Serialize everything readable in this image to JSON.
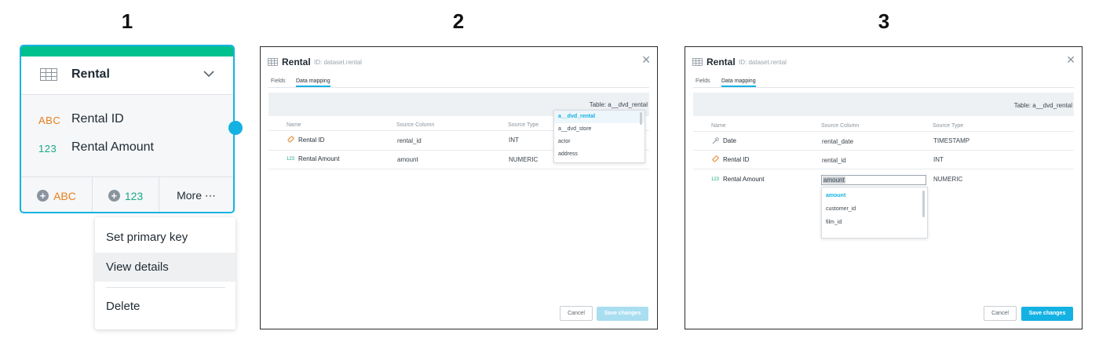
{
  "steps": [
    "1",
    "2",
    "3"
  ],
  "panel1": {
    "card": {
      "title": "Rental",
      "fields": [
        {
          "type": "ABC",
          "name": "Rental ID",
          "type_color": "#e87f1a"
        },
        {
          "type": "123",
          "name": "Rental Amount",
          "type_color": "#1aa882"
        }
      ],
      "footer": {
        "add_attribute_label": "ABC",
        "add_fact_label": "123",
        "more_label": "More ⋯"
      }
    },
    "menu": {
      "items": [
        "Set primary key",
        "View details",
        "Delete"
      ],
      "highlighted": "View details"
    }
  },
  "dialog2": {
    "title": "Rental",
    "id_text": "ID: dataset.rental",
    "tabs": [
      "Fields",
      "Data mapping"
    ],
    "active_tab": "Data mapping",
    "table_label": "Table: a__dvd_rental",
    "columns": [
      "Name",
      "Source Column",
      "Source Type"
    ],
    "rows": [
      {
        "icon": "key-icon",
        "name": "Rental ID",
        "source": "rental_id",
        "type": "INT"
      },
      {
        "icon": "123",
        "name": "Rental Amount",
        "source": "amount",
        "type": "NUMERIC"
      }
    ],
    "dropdown": [
      "a__dvd_rental",
      "a__dvd_store",
      "actor",
      "address"
    ],
    "dropdown_selected": "a__dvd_rental",
    "cancel_label": "Cancel",
    "save_label": "Save changes",
    "save_enabled": false
  },
  "dialog3": {
    "title": "Rental",
    "id_text": "ID: dataset.rental",
    "tabs": [
      "Fields",
      "Data mapping"
    ],
    "active_tab": "Data mapping",
    "table_label": "Table: a__dvd_rental",
    "columns": [
      "Name",
      "Source Column",
      "Source Type"
    ],
    "rows": [
      {
        "icon": "date-icon",
        "name": "Date",
        "source": "rental_date",
        "type": "TIMESTAMP"
      },
      {
        "icon": "key-icon",
        "name": "Rental ID",
        "source": "rental_id",
        "type": "INT"
      },
      {
        "icon": "123",
        "name": "Rental Amount",
        "source": "amount",
        "type": "NUMERIC"
      }
    ],
    "dropdown": [
      "amount",
      "customer_id",
      "film_id"
    ],
    "dropdown_selected": "amount",
    "cancel_label": "Cancel",
    "save_label": "Save changes",
    "save_enabled": true
  },
  "colors": {
    "accent": "#14b2e2",
    "green_bar": "#00c18d",
    "attribute": "#e87f1a",
    "fact": "#1aa882",
    "save_disabled": "#a9def1"
  }
}
